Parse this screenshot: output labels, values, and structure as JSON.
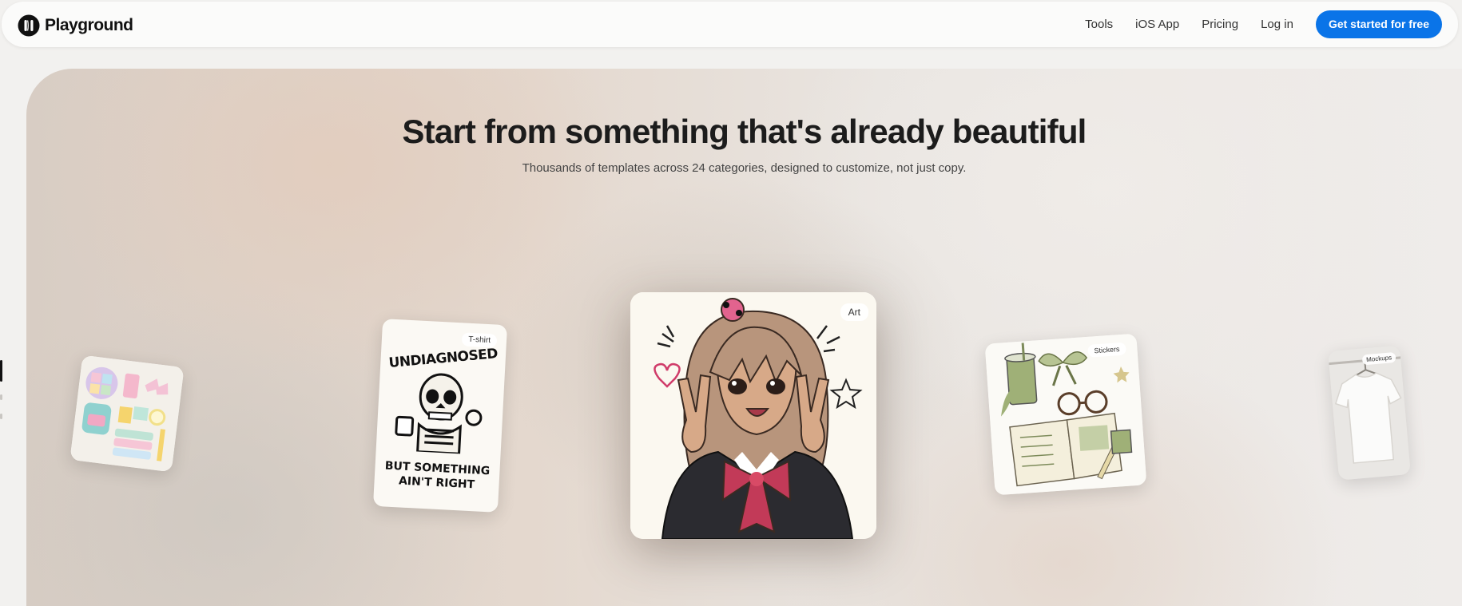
{
  "header": {
    "brand_name": "Playground",
    "nav": [
      "Tools",
      "iOS App",
      "Pricing",
      "Log in"
    ],
    "cta_label": "Get started for free",
    "cta_color": "#0a74e8"
  },
  "hero": {
    "title": "Start from something that's already beautiful",
    "subtitle": "Thousands of templates across 24 categories, designed to customize, not just copy."
  },
  "cards": {
    "main_tag": "Art",
    "tshirt_tag": "T-shirt",
    "tshirt_text_top": "UNDIAGNOSED",
    "tshirt_text_bottom_1": "BUT SOMETHING",
    "tshirt_text_bottom_2": "AIN'T RIGHT",
    "stickers_tag": "Stickers",
    "mockups_tag": "Mockups"
  }
}
